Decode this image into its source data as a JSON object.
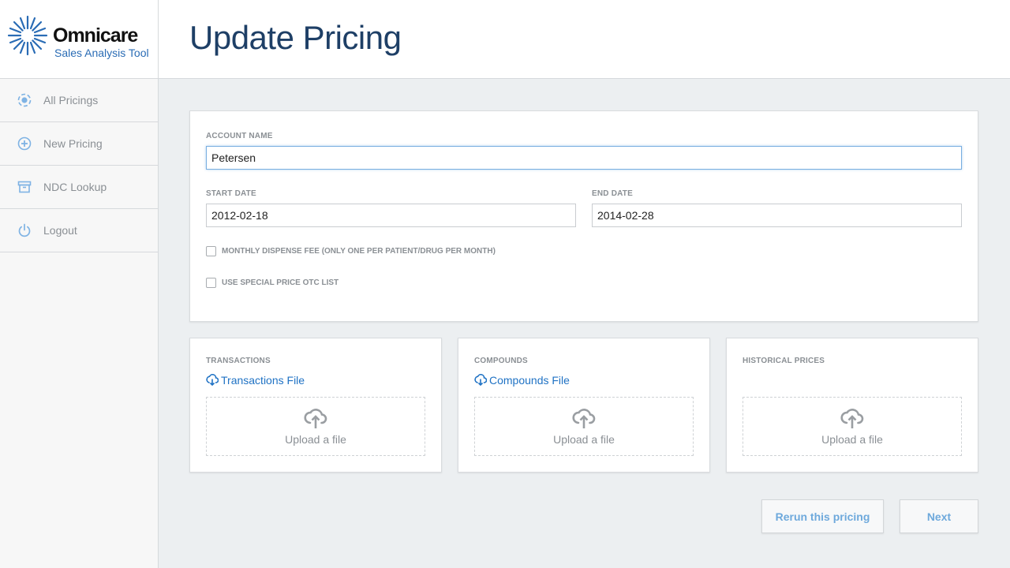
{
  "app": {
    "brand": "Omnicare",
    "subtitle": "Sales Analysis Tool"
  },
  "sidebar": {
    "items": [
      {
        "label": "All Pricings",
        "icon": "target-icon"
      },
      {
        "label": "New Pricing",
        "icon": "plus-circle-icon"
      },
      {
        "label": "NDC Lookup",
        "icon": "archive-box-icon"
      },
      {
        "label": "Logout",
        "icon": "power-icon"
      }
    ]
  },
  "header": {
    "title": "Update Pricing"
  },
  "form": {
    "account_name_label": "ACCOUNT NAME",
    "account_name_value": "Petersen",
    "start_date_label": "START DATE",
    "start_date_value": "2012-02-18",
    "end_date_label": "END DATE",
    "end_date_value": "2014-02-28",
    "monthly_fee_label": "MONTHLY DISPENSE FEE (ONLY ONE PER PATIENT/DRUG PER MONTH)",
    "monthly_fee_checked": false,
    "special_price_label": "USE SPECIAL PRICE OTC LIST",
    "special_price_checked": false
  },
  "uploads": [
    {
      "title": "TRANSACTIONS",
      "file_link": "Transactions File",
      "upload_label": "Upload a file"
    },
    {
      "title": "COMPOUNDS",
      "file_link": "Compounds File",
      "upload_label": "Upload a file"
    },
    {
      "title": "HISTORICAL PRICES",
      "file_link": "",
      "upload_label": "Upload a file"
    }
  ],
  "actions": {
    "rerun_label": "Rerun this pricing",
    "next_label": "Next"
  },
  "colors": {
    "accent": "#6ea9dc",
    "link": "#1f72c4",
    "title": "#1e3f66",
    "logo_blue": "#2a6cb5"
  }
}
